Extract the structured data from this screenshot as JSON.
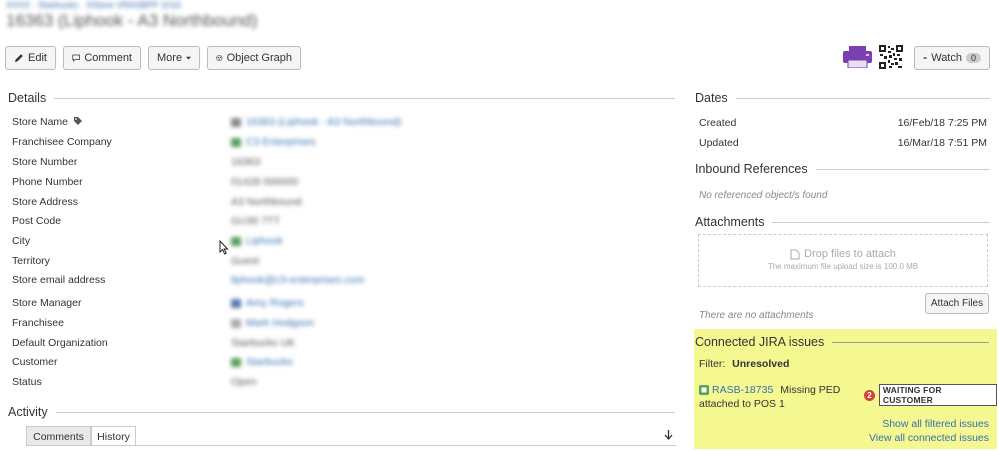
{
  "breadcrumb": "XXXX · Starbucks · XStore VRASBPP 1016",
  "page_title": "16363 (Liphook - A3 Northbound)",
  "toolbar": {
    "edit_label": "Edit",
    "comment_label": "Comment",
    "more_label": "More",
    "object_graph_label": "Object Graph",
    "watch_label": "Watch",
    "watch_count": "0"
  },
  "details": {
    "heading": "Details",
    "fields": [
      {
        "label": "Store Name",
        "value": "16363 (Liphook - A3 Northbound)"
      },
      {
        "label": "Franchisee Company",
        "value": "C3 Enterprises"
      },
      {
        "label": "Store Number",
        "value": "16363"
      },
      {
        "label": "Phone Number",
        "value": "01428 000000"
      },
      {
        "label": "Store Address",
        "value": "A3 Northbound"
      },
      {
        "label": "Post Code",
        "value": "GU30 7TT"
      },
      {
        "label": "City",
        "value": "Liphook"
      },
      {
        "label": "Territory",
        "value": "Guest"
      },
      {
        "label": "Store email address",
        "value": "liphook@c3-enterprises.com"
      },
      {
        "label": "Store Manager",
        "value": "Amy Rogers"
      },
      {
        "label": "Franchisee",
        "value": "Mark Hodgson"
      },
      {
        "label": "Default Organization",
        "value": "Starbucks UK"
      },
      {
        "label": "Customer",
        "value": "Starbucks"
      },
      {
        "label": "Status",
        "value": "Open"
      }
    ]
  },
  "activity": {
    "heading": "Activity",
    "tabs": [
      "Comments",
      "History"
    ]
  },
  "dates": {
    "heading": "Dates",
    "created_label": "Created",
    "created_value": "16/Feb/18 7:25 PM",
    "updated_label": "Updated",
    "updated_value": "16/Mar/18 7:51 PM"
  },
  "inbound": {
    "heading": "Inbound References",
    "empty_text": "No referenced object/s found"
  },
  "attachments": {
    "heading": "Attachments",
    "drop_text": "Drop files to attach",
    "max_size_text": "The maximum file upload size is 100.0 MB",
    "attach_button": "Attach Files",
    "empty_text": "There are no attachments"
  },
  "jira": {
    "heading": "Connected JIRA issues",
    "filter_label": "Filter:",
    "filter_value": "Unresolved",
    "issue_key": "RASB-18735",
    "issue_summary_1": "Missing PED",
    "issue_summary_2": "attached to POS 1",
    "issue_count": "2",
    "issue_status": "WAITING FOR CUSTOMER",
    "show_filtered": "Show all filtered issues",
    "view_connected": "View all connected issues",
    "highlight_color": "#f5f790"
  }
}
